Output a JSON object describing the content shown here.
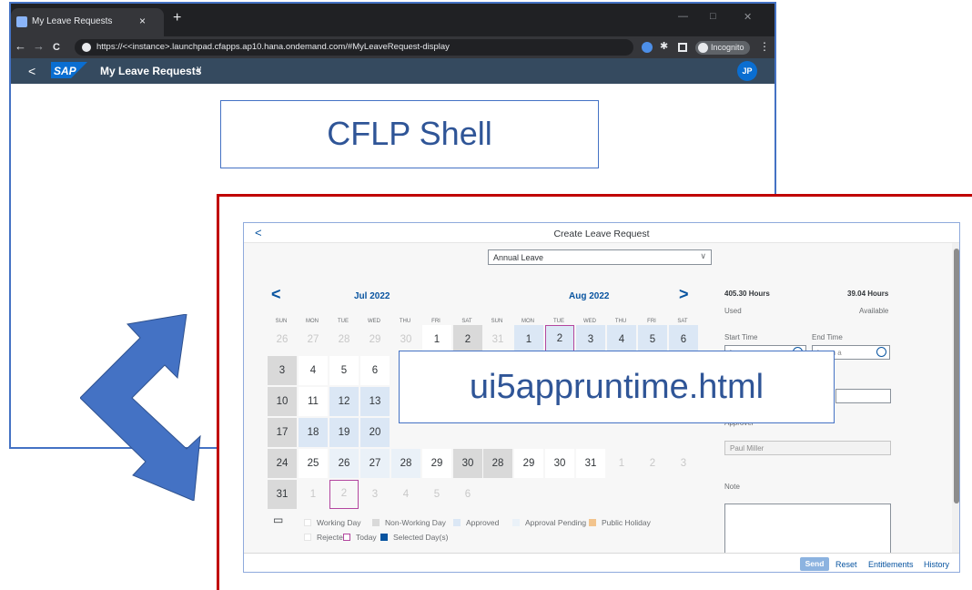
{
  "browser": {
    "tab_title": "My Leave Requests",
    "tab_close": "×",
    "tab_new": "+",
    "url": "https://<<instance>.launchpad.cfapps.ap10.hana.ondemand.com/#MyLeaveRequest-display",
    "incognito": "Incognito",
    "win_min": "—",
    "win_max": "□",
    "win_close": "✕",
    "back": "←",
    "forward": "→",
    "reload": "C",
    "menu": "⋮"
  },
  "shell": {
    "back": "<",
    "logo": "SAP",
    "title": "My Leave Requests",
    "chevron": "∨",
    "avatar": "JP"
  },
  "callouts": {
    "shell": "CFLP Shell",
    "app": "ui5appruntime.html"
  },
  "app": {
    "back": "<",
    "title": "Create Leave Request",
    "leave_type": "Annual Leave",
    "select_arrow": "∨",
    "nav_prev": "<",
    "nav_next": ">",
    "months": [
      "Jul 2022",
      "Aug 2022"
    ],
    "weekdays": [
      "SUN",
      "MON",
      "TUE",
      "WED",
      "THU",
      "FRI",
      "SAT"
    ],
    "used_value": "405.30 Hours",
    "used_label": "Used",
    "available_value": "39.04 Hours",
    "available_label": "Available",
    "start_time_label": "Start Time",
    "end_time_label": "End Time",
    "time_placeholder": "h:mm a",
    "approver_label": "Approver",
    "approver_value": "Paul Miller",
    "note_label": "Note",
    "legend": [
      "Working Day",
      "Non-Working Day",
      "Approved",
      "Approval Pending",
      "Public Holiday",
      "Rejected",
      "Today",
      "Selected Day(s)"
    ],
    "legend_colors": [
      "#ffffff",
      "#d9d9d9",
      "#dbe7f5",
      "#eaf1f8",
      "#f2c48d",
      "#ffffff",
      "#b3469f",
      "#0854a0"
    ],
    "footer": {
      "send": "Send",
      "reset": "Reset",
      "entitlements": "Entitlements",
      "history": "History"
    }
  },
  "calendar": {
    "jul": [
      [
        {
          "d": "26",
          "s": "other"
        },
        {
          "d": "27",
          "s": "other"
        },
        {
          "d": "28",
          "s": "other"
        },
        {
          "d": "29",
          "s": "other"
        },
        {
          "d": "30",
          "s": "other"
        },
        {
          "d": "1",
          "s": "wd"
        },
        {
          "d": "2",
          "s": "nw"
        }
      ],
      [
        {
          "d": "3",
          "s": "nw"
        },
        {
          "d": "4",
          "s": "wd"
        },
        {
          "d": "5",
          "s": "wd"
        },
        {
          "d": "6",
          "s": "wd"
        },
        {
          "d": "",
          "s": "hidden"
        },
        {
          "d": "",
          "s": "hidden"
        },
        {
          "d": "",
          "s": "hidden"
        }
      ],
      [
        {
          "d": "10",
          "s": "nw"
        },
        {
          "d": "11",
          "s": "wd"
        },
        {
          "d": "12",
          "s": "ap"
        },
        {
          "d": "13",
          "s": "ap"
        },
        {
          "d": "",
          "s": "hidden"
        },
        {
          "d": "",
          "s": "hidden"
        },
        {
          "d": "",
          "s": "hidden"
        }
      ],
      [
        {
          "d": "17",
          "s": "nw"
        },
        {
          "d": "18",
          "s": "ap"
        },
        {
          "d": "19",
          "s": "ap"
        },
        {
          "d": "20",
          "s": "ap"
        },
        {
          "d": "",
          "s": "hidden"
        },
        {
          "d": "",
          "s": "hidden"
        },
        {
          "d": "",
          "s": "hidden"
        }
      ],
      [
        {
          "d": "24",
          "s": "nw"
        },
        {
          "d": "25",
          "s": "wd"
        },
        {
          "d": "26",
          "s": "pend"
        },
        {
          "d": "27",
          "s": "pend"
        },
        {
          "d": "28",
          "s": "pend"
        },
        {
          "d": "29",
          "s": "wd"
        },
        {
          "d": "30",
          "s": "nw"
        }
      ],
      [
        {
          "d": "31",
          "s": "nw"
        },
        {
          "d": "1",
          "s": "other"
        },
        {
          "d": "2",
          "s": "today"
        },
        {
          "d": "3",
          "s": "other"
        },
        {
          "d": "4",
          "s": "other"
        },
        {
          "d": "5",
          "s": "other"
        },
        {
          "d": "6",
          "s": "other"
        }
      ]
    ],
    "aug": [
      [
        {
          "d": "31",
          "s": "other"
        },
        {
          "d": "1",
          "s": "ap"
        },
        {
          "d": "2",
          "s": "today-ap"
        },
        {
          "d": "3",
          "s": "ap"
        },
        {
          "d": "4",
          "s": "ap"
        },
        {
          "d": "5",
          "s": "ap"
        },
        {
          "d": "6",
          "s": "ap"
        }
      ],
      [
        {
          "d": "",
          "s": "hidden"
        },
        {
          "d": "",
          "s": "hidden"
        },
        {
          "d": "",
          "s": "hidden"
        },
        {
          "d": "",
          "s": "hidden"
        },
        {
          "d": "",
          "s": "hidden"
        },
        {
          "d": "",
          "s": "hidden"
        },
        {
          "d": "",
          "s": "hidden"
        }
      ],
      [
        {
          "d": "",
          "s": "hidden"
        },
        {
          "d": "",
          "s": "hidden"
        },
        {
          "d": "",
          "s": "hidden"
        },
        {
          "d": "",
          "s": "hidden"
        },
        {
          "d": "",
          "s": "hidden"
        },
        {
          "d": "",
          "s": "hidden"
        },
        {
          "d": "",
          "s": "hidden"
        }
      ],
      [
        {
          "d": "",
          "s": "hidden"
        },
        {
          "d": "",
          "s": "hidden"
        },
        {
          "d": "",
          "s": "hidden"
        },
        {
          "d": "",
          "s": "hidden"
        },
        {
          "d": "",
          "s": "hidden"
        },
        {
          "d": "",
          "s": "hidden"
        },
        {
          "d": "",
          "s": "hidden"
        }
      ],
      [
        {
          "d": "28",
          "s": "nw"
        },
        {
          "d": "29",
          "s": "wd"
        },
        {
          "d": "30",
          "s": "wd"
        },
        {
          "d": "31",
          "s": "wd"
        },
        {
          "d": "1",
          "s": "other"
        },
        {
          "d": "2",
          "s": "other"
        },
        {
          "d": "3",
          "s": "other"
        }
      ]
    ]
  }
}
